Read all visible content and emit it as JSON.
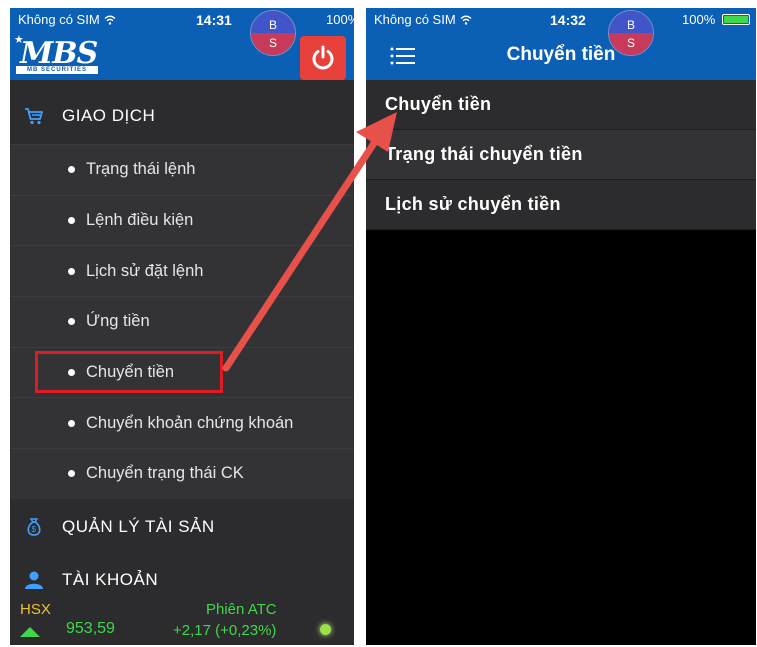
{
  "left_phone": {
    "status": {
      "carrier": "Không có SIM",
      "time": "14:31",
      "battery": "100%"
    },
    "badge": {
      "top": "B",
      "bottom": "S"
    },
    "logo": {
      "text": "MBS",
      "sub": "MB SECURITIES"
    },
    "menu": {
      "giao_dich": {
        "label": "GIAO DỊCH",
        "icon": "cart-icon"
      },
      "items": [
        {
          "label": "Trạng thái lệnh"
        },
        {
          "label": "Lệnh điều kiện"
        },
        {
          "label": "Lịch sử đặt lệnh"
        },
        {
          "label": "Ứng tiền"
        },
        {
          "label": "Chuyển tiền",
          "highlighted": true
        },
        {
          "label": "Chuyển khoản chứng khoán"
        },
        {
          "label": "Chuyển trạng thái CK"
        }
      ],
      "quan_ly_tai_san": {
        "label": "QUẢN LÝ TÀI SẢN",
        "icon": "money-bag-icon"
      },
      "tai_khoan": {
        "label": "TÀI KHOẢN",
        "icon": "user-icon"
      }
    },
    "ticker": {
      "exchange": "HSX",
      "session": "Phiên ATC",
      "index": "953,59",
      "change": "+2,17 (+0,23%)",
      "direction": "up"
    }
  },
  "right_phone": {
    "status": {
      "carrier": "Không có SIM",
      "time": "14:32",
      "battery": "100%"
    },
    "badge": {
      "top": "B",
      "bottom": "S"
    },
    "title": "Chuyển tiền",
    "items": [
      {
        "label": "Chuyển tiền"
      },
      {
        "label": "Trạng thái chuyển tiền"
      },
      {
        "label": "Lịch sử chuyển tiền"
      }
    ]
  },
  "colors": {
    "header_blue": "#0b5fb5",
    "highlight_red": "#e01b24",
    "arrow_red": "#e8504a",
    "ticker_green": "#3fd84a",
    "ticker_yellow": "#f0c12b"
  }
}
